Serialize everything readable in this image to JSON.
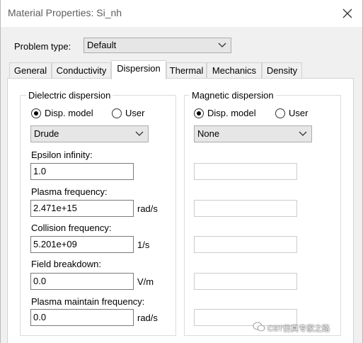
{
  "window": {
    "title": "Material Properties: Si_nh"
  },
  "problem_type": {
    "label": "Problem type:",
    "value": "Default"
  },
  "tabs": [
    "General",
    "Conductivity",
    "Dispersion",
    "Thermal",
    "Mechanics",
    "Density"
  ],
  "active_tab": "Dispersion",
  "dielectric": {
    "legend": "Dielectric dispersion",
    "radio_model": "Disp. model",
    "radio_user": "User",
    "selected": "Disp. model",
    "model": "Drude",
    "fields": [
      {
        "label": "Epsilon infinity:",
        "value": "1.0",
        "unit": ""
      },
      {
        "label": "Plasma frequency:",
        "value": "2.471e+15",
        "unit": "rad/s"
      },
      {
        "label": "Collision frequency:",
        "value": "5.201e+09",
        "unit": "1/s"
      },
      {
        "label": "Field breakdown:",
        "value": "0.0",
        "unit": "V/m"
      },
      {
        "label": "Plasma maintain frequency:",
        "value": "0.0",
        "unit": "rad/s"
      }
    ]
  },
  "magnetic": {
    "legend": "Magnetic dispersion",
    "radio_model": "Disp. model",
    "radio_user": "User",
    "selected": "Disp. model",
    "model": "None"
  },
  "watermark": "CST仿真专家之路"
}
